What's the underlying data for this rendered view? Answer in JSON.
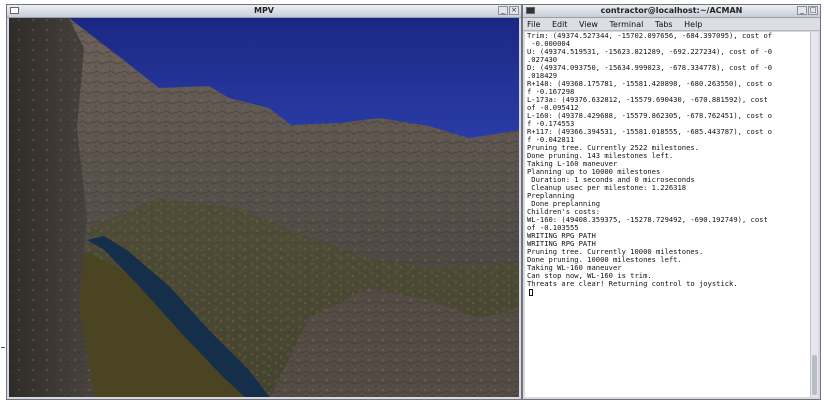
{
  "mpv_window": {
    "title": "MPV",
    "minimize": "_",
    "close": "×"
  },
  "terminal_window": {
    "title": "contractor@localhost:~/ACMAN",
    "minimize": "_",
    "maximize": "□",
    "menu": [
      "File",
      "Edit",
      "View",
      "Terminal",
      "Tabs",
      "Help"
    ],
    "lines": [
      "Trim: (49374.527344, -15702.097656, -684.397095), cost of",
      " -0.000004",
      "U: (49374.519531, -15623.821289, -692.227234), cost of -0",
      ".027430",
      "D: (49374.093750, -15634.999023, -678.334778), cost of -0",
      ".018429",
      "R+148: (49368.175781, -15581.420898, -680.263550), cost o",
      "f -0.167298",
      "L-173a: (49376.632812, -15579.690430, -670.881592), cost",
      "of -0.095412",
      "L-160: (49378.429688, -15579.862305, -678.762451), cost o",
      "f -0.174553",
      "R+117: (49366.394531, -15581.018555, -685.443787), cost o",
      "f -0.042811",
      "Pruning tree. Currently 2522 milestones.",
      "Done pruning. 143 milestones left.",
      "Taking L-160 maneuver",
      "Planning up to 10000 milestones",
      " Duration: 1 seconds and 0 microseconds",
      " Cleanup usec per milestone: 1.226318",
      "Preplanning",
      " Done preplanning",
      "",
      "Children's costs:",
      "WL-160: (49408.359375, -15278.729492, -690.192749), cost",
      "of -0.103555",
      "WRITING RPG PATH",
      "WRITING RPG PATH",
      "Pruning tree. Currently 10000 milestones.",
      "Done pruning. 10000 milestones left.",
      "Taking WL-160 maneuver",
      "Can stop now, WL-160 is trim.",
      "Threats are clear! Returning control to joystick."
    ]
  },
  "colors": {
    "sky_top": "#1d2a8a",
    "sky_bottom": "#4a66d4",
    "terrain": "#5a5048",
    "river": "#14304a",
    "terminal_bg": "#ffffff",
    "terminal_fg": "#111111"
  }
}
